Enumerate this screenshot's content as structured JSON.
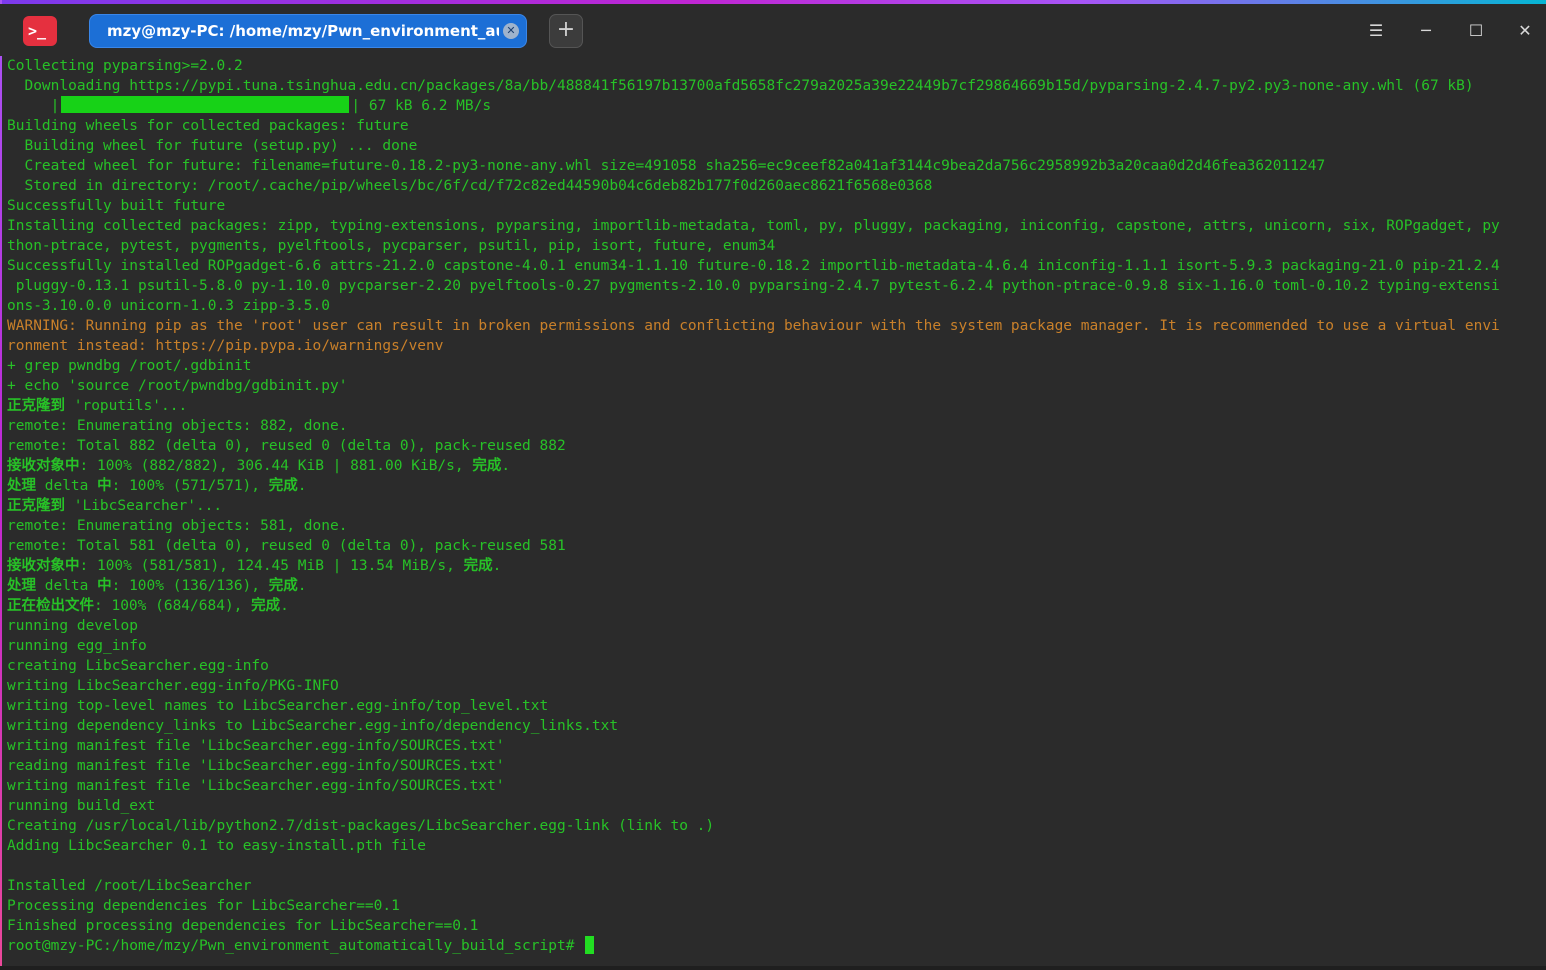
{
  "window": {
    "tab_title": "mzy@mzy-PC: /home/mzy/Pwn_environment_automaticall···",
    "app_icon_glyph": ">_",
    "new_tab_glyph": "+",
    "menu_glyph": "☰",
    "minimize_glyph": "─",
    "maximize_glyph": "☐",
    "close_glyph": "✕",
    "tab_close_glyph": "✕"
  },
  "colors": {
    "terminal_text": "#27c227",
    "warning_text": "#c9802a",
    "tab_active": "#1c6fd6",
    "app_icon": "#e5303f"
  },
  "terminal": {
    "l01": "Collecting pyparsing>=2.0.2",
    "l02": "  Downloading https://pypi.tuna.tsinghua.edu.cn/packages/8a/bb/488841f56197b13700afd5658fc279a2025a39e22449b7cf29864669b15d/pyparsing-2.4.7-py2.py3-none-any.whl (67 kB)",
    "l03_prefix": "     |",
    "l03_suffix": "| 67 kB 6.2 MB/s",
    "l03_progress": 1.0,
    "l04": "Building wheels for collected packages: future",
    "l05": "  Building wheel for future (setup.py) ... done",
    "l06": "  Created wheel for future: filename=future-0.18.2-py3-none-any.whl size=491058 sha256=ec9ceef82a041af3144c9bea2da756c2958992b3a20caa0d2d46fea362011247",
    "l07": "  Stored in directory: /root/.cache/pip/wheels/bc/6f/cd/f72c82ed44590b04c6deb82b177f0d260aec8621f6568e0368",
    "l08": "Successfully built future",
    "l09": "Installing collected packages: zipp, typing-extensions, pyparsing, importlib-metadata, toml, py, pluggy, packaging, iniconfig, capstone, attrs, unicorn, six, ROPgadget, py",
    "l10": "thon-ptrace, pytest, pygments, pyelftools, pycparser, psutil, pip, isort, future, enum34",
    "l11": "Successfully installed ROPgadget-6.6 attrs-21.2.0 capstone-4.0.1 enum34-1.1.10 future-0.18.2 importlib-metadata-4.6.4 iniconfig-1.1.1 isort-5.9.3 packaging-21.0 pip-21.2.4",
    "l12": " pluggy-0.13.1 psutil-5.8.0 py-1.10.0 pycparser-2.20 pyelftools-0.27 pygments-2.10.0 pyparsing-2.4.7 pytest-6.2.4 python-ptrace-0.9.8 six-1.16.0 toml-0.10.2 typing-extensi",
    "l13": "ons-3.10.0.0 unicorn-1.0.3 zipp-3.5.0",
    "l14": "WARNING: Running pip as the 'root' user can result in broken permissions and conflicting behaviour with the system package manager. It is recommended to use a virtual envi",
    "l15": "ronment instead: https://pip.pypa.io/warnings/venv",
    "l16": "+ grep pwndbg /root/.gdbinit",
    "l17": "+ echo 'source /root/pwndbg/gdbinit.py'",
    "l18_cjk": "正克隆到",
    "l18": " 'roputils'...",
    "l19": "remote: Enumerating objects: 882, done.",
    "l20": "remote: Total 882 (delta 0), reused 0 (delta 0), pack-reused 882",
    "l21_cjk": "接收对象中",
    "l21": ": 100% (882/882), 306.44 KiB | 881.00 KiB/s, ",
    "l21_done": "完成",
    "l21_end": ".",
    "l22_cjk": "处理",
    "l22_mid": " delta ",
    "l22_cjk2": "中",
    "l22": ": 100% (571/571), ",
    "l22_done": "完成",
    "l22_end": ".",
    "l23_cjk": "正克隆到",
    "l23": " 'LibcSearcher'...",
    "l24": "remote: Enumerating objects: 581, done.",
    "l25": "remote: Total 581 (delta 0), reused 0 (delta 0), pack-reused 581",
    "l26_cjk": "接收对象中",
    "l26": ": 100% (581/581), 124.45 MiB | 13.54 MiB/s, ",
    "l26_done": "完成",
    "l26_end": ".",
    "l27_cjk": "处理",
    "l27_mid": " delta ",
    "l27_cjk2": "中",
    "l27": ": 100% (136/136), ",
    "l27_done": "完成",
    "l27_end": ".",
    "l28_cjk": "正在检出文件",
    "l28": ": 100% (684/684), ",
    "l28_done": "完成",
    "l28_end": ".",
    "l29": "running develop",
    "l30": "running egg_info",
    "l31": "creating LibcSearcher.egg-info",
    "l32": "writing LibcSearcher.egg-info/PKG-INFO",
    "l33": "writing top-level names to LibcSearcher.egg-info/top_level.txt",
    "l34": "writing dependency_links to LibcSearcher.egg-info/dependency_links.txt",
    "l35": "writing manifest file 'LibcSearcher.egg-info/SOURCES.txt'",
    "l36": "reading manifest file 'LibcSearcher.egg-info/SOURCES.txt'",
    "l37": "writing manifest file 'LibcSearcher.egg-info/SOURCES.txt'",
    "l38": "running build_ext",
    "l39": "Creating /usr/local/lib/python2.7/dist-packages/LibcSearcher.egg-link (link to .)",
    "l40": "Adding LibcSearcher 0.1 to easy-install.pth file",
    "l41": "",
    "l42": "Installed /root/LibcSearcher",
    "l43": "Processing dependencies for LibcSearcher==0.1",
    "l44": "Finished processing dependencies for LibcSearcher==0.1",
    "prompt": "root@mzy-PC:/home/mzy/Pwn_environment_automatically_build_script# "
  }
}
